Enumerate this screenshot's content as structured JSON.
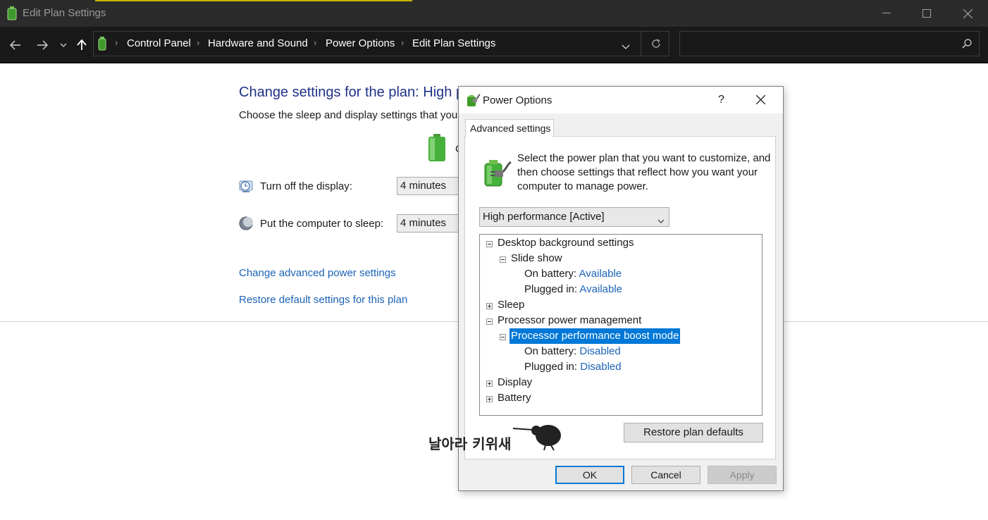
{
  "window": {
    "title": "Edit Plan Settings",
    "icons": {
      "app": "battery-icon",
      "minimize": "minimize-icon",
      "maximize": "maximize-icon",
      "close": "close-icon"
    }
  },
  "nav": {
    "breadcrumbs": [
      "Control Panel",
      "Hardware and Sound",
      "Power Options",
      "Edit Plan Settings"
    ],
    "icons": {
      "back": "back-arrow-icon",
      "forward": "forward-arrow-icon",
      "recent": "chevron-down-icon",
      "up": "up-arrow-icon",
      "refresh": "refresh-icon",
      "search": "search-icon"
    },
    "search_placeholder": ""
  },
  "page": {
    "title": "Change settings for the plan: High p",
    "subtitle": "Choose the sleep and display settings that you v",
    "column_header_fragment": "C",
    "settings": [
      {
        "label": "Turn off the display:",
        "value": "4 minutes",
        "icon": "display-clock-icon"
      },
      {
        "label": "Put the computer to sleep:",
        "value": "4 minutes",
        "icon": "moon-icon"
      }
    ],
    "links": [
      "Change advanced power settings",
      "Restore default settings for this plan"
    ],
    "colors": {
      "title": "#1e3287",
      "link": "#1b63b5"
    }
  },
  "dialog": {
    "title": "Power Options",
    "help_label": "?",
    "tab_label": "Advanced settings",
    "intro": "Select the power plan that you want to customize, and then choose settings that reflect how you want your computer to manage power.",
    "plan_select": "High performance [Active]",
    "tree": [
      {
        "label": "Desktop background settings",
        "expanded": true
      },
      {
        "label": "Slide show",
        "expanded": true
      },
      {
        "label": "On battery:",
        "value": "Available"
      },
      {
        "label": "Plugged in:",
        "value": "Available"
      },
      {
        "label": "Sleep",
        "expanded": false
      },
      {
        "label": "Processor power management",
        "expanded": true
      },
      {
        "label": "Processor performance boost mode",
        "expanded": true,
        "selected": true
      },
      {
        "label": "On battery:",
        "value": "Disabled"
      },
      {
        "label": "Plugged in:",
        "value": "Disabled"
      },
      {
        "label": "Display",
        "expanded": false
      },
      {
        "label": "Battery",
        "expanded": false
      }
    ],
    "restore_button": "Restore plan defaults",
    "buttons": {
      "ok": "OK",
      "cancel": "Cancel",
      "apply": "Apply"
    },
    "colors": {
      "selection": "#0078d7"
    }
  },
  "watermark": {
    "text": "날아라 키위새",
    "icon": "kiwi-bird-icon"
  }
}
